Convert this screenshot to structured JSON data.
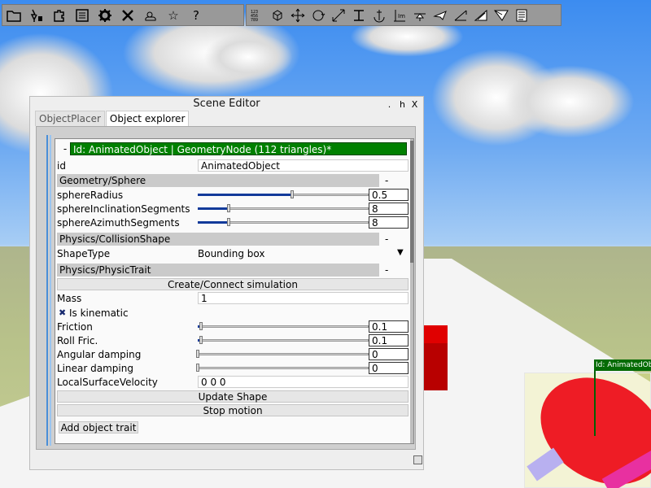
{
  "toolbar_left": [
    "folder-icon",
    "tree-icon",
    "puzzle-icon",
    "list-icon",
    "gear-icon",
    "tools-icon",
    "weather-icon",
    "star-icon",
    "help-icon"
  ],
  "toolbar_right": [
    "numbers-icon",
    "cube-icon",
    "move-icon",
    "rotate-icon",
    "scale-icon",
    "ground-icon",
    "anchor-icon",
    "text-icon",
    "drop-icon",
    "plane-icon",
    "ramp-icon",
    "wedge-icon",
    "paper-plane-icon",
    "notes-icon"
  ],
  "toolbar_glyphs": {
    "help": "?",
    "star": "☆",
    "numbers": "1 2 3\n4 5 6\n7 8 9",
    "text": "Im"
  },
  "window": {
    "title": "Scene Editor",
    "buttons": [
      ".",
      "h",
      "X"
    ],
    "tabs": [
      "ObjectPlacer",
      "Object explorer"
    ],
    "active_tab": "Object explorer"
  },
  "inspector": {
    "collapse_symbol": "-",
    "title": "Id: AnimatedObject | GeometryNode (112 triangles)*",
    "id_label": "id",
    "id_value": "AnimatedObject",
    "geometry_header": "Geometry/Sphere",
    "section_minus": "-",
    "sphere_radius": {
      "label": "sphereRadius",
      "value": "0.5",
      "fraction": 0.55
    },
    "sphere_incl": {
      "label": "sphereInclinationSegments",
      "value": "8",
      "fraction": 0.18
    },
    "sphere_azim": {
      "label": "sphereAzimuthSegments",
      "value": "8",
      "fraction": 0.18
    },
    "collision_header": "Physics/CollisionShape",
    "shape_type_label": "ShapeType",
    "shape_type_value": "Bounding box",
    "dropdown_arrow": "▼",
    "physic_header": "Physics/PhysicTrait",
    "create_button": "Create/Connect simulation",
    "mass_label": "Mass",
    "mass_value": "1",
    "kinematic_check": "✖",
    "kinematic_label": "Is kinematic",
    "friction": {
      "label": "Friction",
      "value": "0.1",
      "fraction": 0.02
    },
    "roll": {
      "label": "Roll Fric.",
      "value": "0.1",
      "fraction": 0.02
    },
    "angular": {
      "label": "Angular damping",
      "value": "0",
      "fraction": 0
    },
    "linear": {
      "label": "Linear damping",
      "value": "0",
      "fraction": 0
    },
    "surface_label": "LocalSurfaceVelocity",
    "surface_value": "0 0 0",
    "update_button": "Update Shape",
    "stop_button": "Stop motion",
    "add_trait_button": "Add object trait"
  },
  "scene": {
    "object_label": "Id: AnimatedObject"
  }
}
